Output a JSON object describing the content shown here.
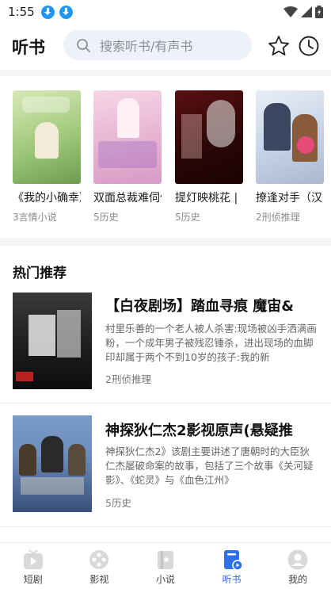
{
  "status_bar": {
    "time": "1:55"
  },
  "header": {
    "title": "听书",
    "search_placeholder": "搜索听书/有声书"
  },
  "carousel": {
    "books": [
      {
        "title": "《我的小确幸》",
        "category": "3言情小说"
      },
      {
        "title": "双面总裁难伺候",
        "category": "5历史"
      },
      {
        "title": "提灯映桃花 |",
        "category": "5历史"
      },
      {
        "title": "撩逢对手（汉",
        "category": "2刑侦推理"
      }
    ]
  },
  "hot_section": {
    "title": "热门推荐",
    "items": [
      {
        "title": "【白夜剧场】踏血寻痕 魔宙&",
        "description": "村里乐善的一个老人被人杀害:现场被凶手洒满画粉，一个成年男子被残忍锤杀，进出现场的血脚印却属于两个不到10岁的孩子:我的新",
        "tag": "2刑侦推理"
      },
      {
        "title": "神探狄仁杰2影视原声(悬疑推",
        "description": "神探狄仁杰2》该剧主要讲述了唐朝时的大臣狄仁杰屡破命案的故事，包括了三个故事《关河疑影》、《蛇灵》与《血色江州》",
        "tag": "5历史"
      }
    ]
  },
  "bottom_nav": {
    "items": [
      {
        "label": "短剧",
        "icon": "short-drama-icon"
      },
      {
        "label": "影视",
        "icon": "film-reel-icon"
      },
      {
        "label": "小说",
        "icon": "book-icon"
      },
      {
        "label": "听书",
        "icon": "audiobook-icon"
      },
      {
        "label": "我的",
        "icon": "profile-icon"
      }
    ],
    "active_index": 3
  },
  "colors": {
    "accent": "#2f6fe8",
    "search_bg": "#eef1f7",
    "divider": "#f4f5f7"
  }
}
